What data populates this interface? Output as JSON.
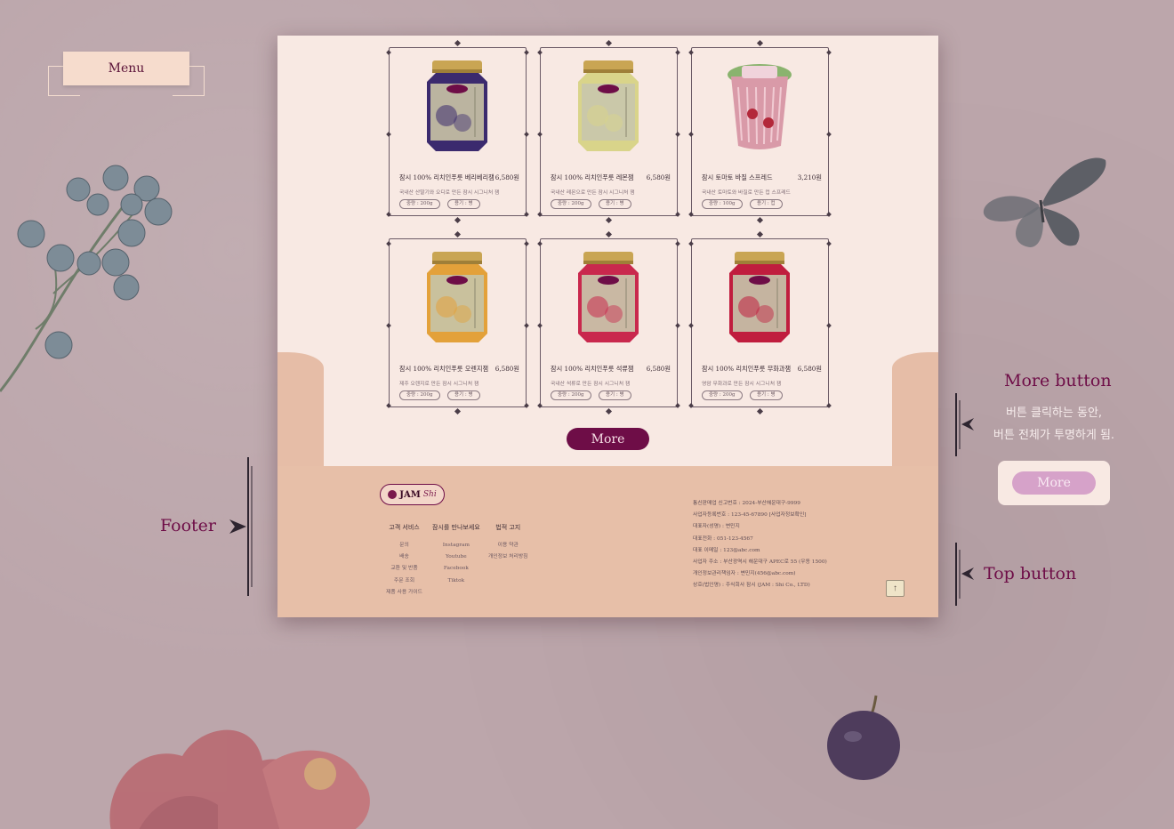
{
  "menu": {
    "label": "Menu"
  },
  "products": [
    {
      "name": "잠시 100% 리치인푸룻 베리베리잼",
      "price": "6,580원",
      "desc": "국내산 산딸기와 오디로 만든 잠시 시그니처 잼",
      "weight": "중량 : 200g",
      "container": "용기 : 병",
      "jar_color": "#3b2a6e",
      "label_color": "#c7c0a4"
    },
    {
      "name": "잠시 100% 리치인푸룻 레몬잼",
      "price": "6,580원",
      "desc": "국내산 레몬으로 만든 잠시 시그니처 잼",
      "weight": "중량 : 200g",
      "container": "용기 : 병",
      "jar_color": "#d9d48a",
      "label_color": "#c9c7ab"
    },
    {
      "name": "잠시 토마토 바질 스프레드",
      "price": "3,210원",
      "desc": "국내산 토마토와 바질로 만든 컵 스프레드",
      "weight": "중량 : 100g",
      "container": "용기 : 컵",
      "jar_color": "#d99aa8",
      "label_color": "#8ab36e"
    },
    {
      "name": "잠시 100% 리치인푸룻 오렌지잼",
      "price": "6,580원",
      "desc": "제주 오렌지로 만든 잠시 시그니처 잼",
      "weight": "중량 : 200g",
      "container": "용기 : 병",
      "jar_color": "#e3a13a",
      "label_color": "#c7c3a6"
    },
    {
      "name": "잠시 100% 리치인푸룻 석류잼",
      "price": "6,580원",
      "desc": "국내산 석류로 만든 잠시 시그니처 잼",
      "weight": "중량 : 200g",
      "container": "용기 : 병",
      "jar_color": "#c9284d",
      "label_color": "#c9c4aa"
    },
    {
      "name": "잠시 100% 리치인푸룻 무화과잼",
      "price": "6,580원",
      "desc": "영암 무화과로 만든 잠시 시그니처 잼",
      "weight": "중량 : 200g",
      "container": "용기 : 병",
      "jar_color": "#c01d3e",
      "label_color": "#c6c1a8"
    }
  ],
  "more_button": {
    "label": "More"
  },
  "footer": {
    "logo": {
      "main": "JAM",
      "script": "Shi"
    },
    "columns": [
      {
        "title": "고객 서비스",
        "items": [
          "문의",
          "배송",
          "교환 및 반품",
          "주문 조회",
          "제품 사용 가이드"
        ]
      },
      {
        "title": "잠시를 만나보세요",
        "items": [
          "Instagram",
          "Youtube",
          "Facebook",
          "Tiktok"
        ]
      },
      {
        "title": "법적 고지",
        "items": [
          "이용 약관",
          "개인정보 처리방침"
        ]
      }
    ],
    "company_info": [
      "통신판매업 신고번호 : 2024-부산해운대구-9999",
      "사업자등록번호 : 123-45-67890 [사업자정보확인]",
      "대표자(성명) : 변민지",
      "대표전화 : 051-123-4567",
      "대표 이메일 : 123@abc.com",
      "사업자 주소 : 부산광역시 해운대구 APEC로 55 (우동 1500)",
      "개인정보관리책임자 : 변민지(456@abc.com)",
      "상호(법인명) : 주식회사 잠시 (JAM : Shi Co., LTD)"
    ],
    "top_button_icon": "arrow-up-icon"
  },
  "annotations": {
    "footer": "Footer",
    "more_button": "More button",
    "more_desc_1": "버튼 클릭하는 동안,",
    "more_desc_2": "버튼 전체가 투명하게 됨.",
    "more_demo_label": "More",
    "top_button": "Top button"
  },
  "colors": {
    "accent": "#6e0d47",
    "paper": "#f8e9e3",
    "footer_bg": "#e7bfa8",
    "background": "#bca6ab"
  }
}
